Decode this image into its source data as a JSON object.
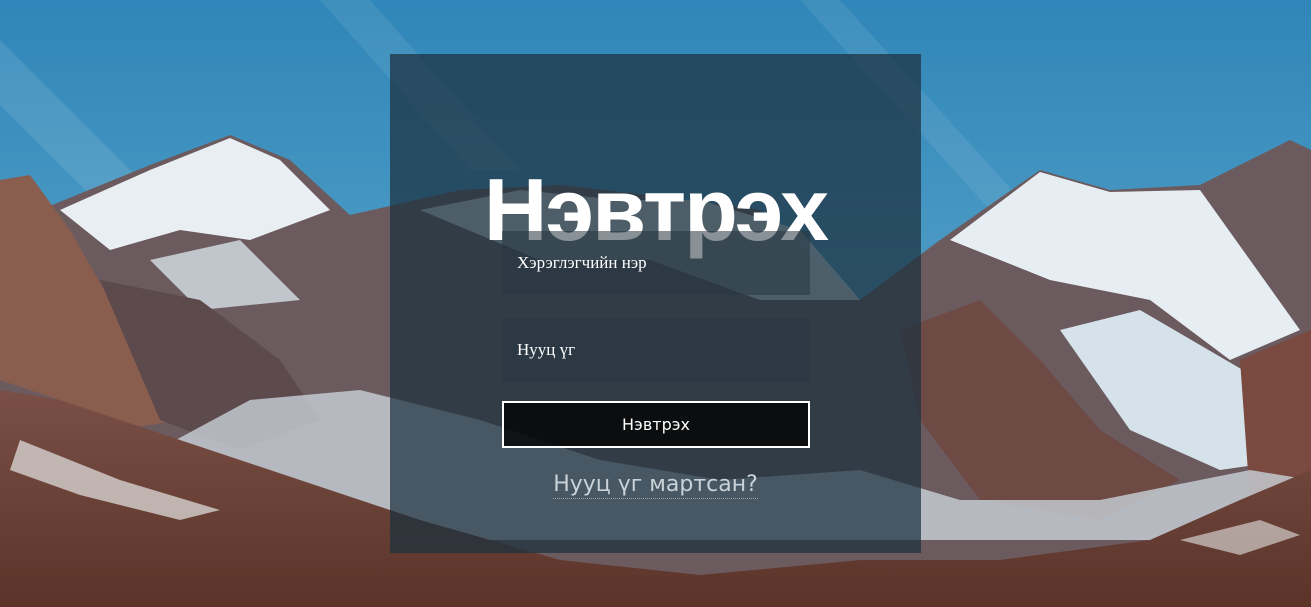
{
  "login": {
    "title": "Нэвтрэх",
    "username_placeholder": "Хэрэглэгчийн нэр",
    "password_placeholder": "Нууц үг",
    "submit_label": "Нэвтрэх",
    "forgot_password_label": "Нууц үг мартсан?"
  },
  "background": {
    "description": "mountain-landscape-image"
  },
  "colors": {
    "panel": "#1c303e",
    "sky": "#3f8fbd",
    "text": "#ffffff"
  }
}
